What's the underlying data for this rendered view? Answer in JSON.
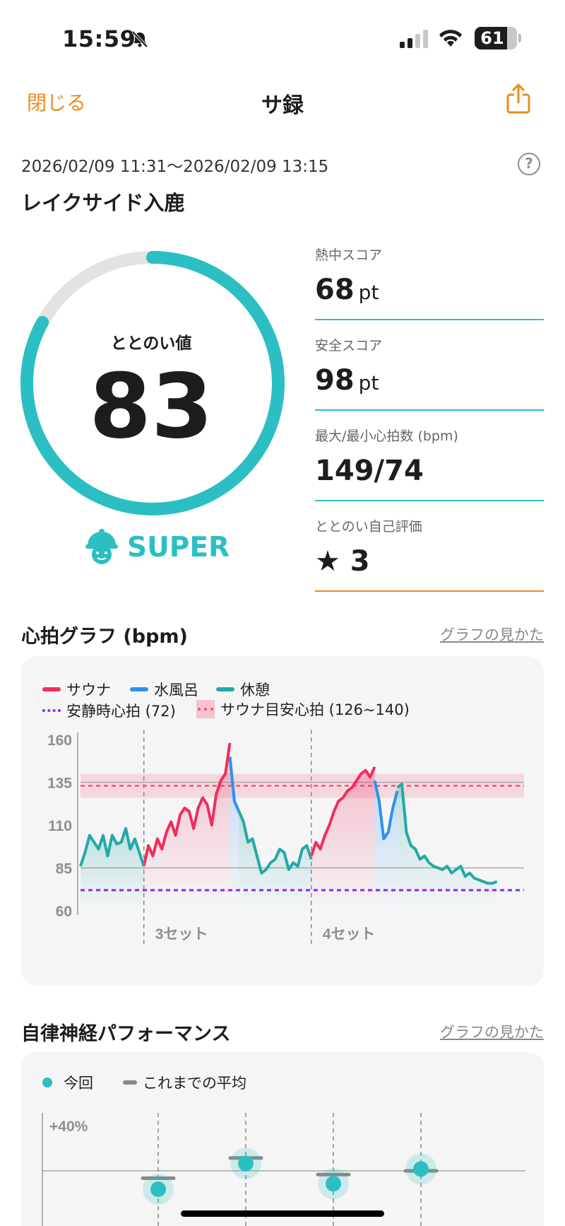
{
  "status": {
    "time": "15:59",
    "battery": "61"
  },
  "nav": {
    "back": "閉じる",
    "title": "サ録"
  },
  "session": {
    "range": "2026/02/09 11:31〜2026/02/09 13:15",
    "place": "レイクサイド入鹿",
    "help": "?"
  },
  "totonoi": {
    "label": "ととのい値",
    "value": "83",
    "percent": 0.83,
    "rank": "SUPER"
  },
  "stats": [
    {
      "label": "熱中スコア",
      "value": "68",
      "unit": "pt"
    },
    {
      "label": "安全スコア",
      "value": "98",
      "unit": "pt"
    },
    {
      "label": "最大/最小心拍数 (bpm)",
      "value": "149/74",
      "unit": ""
    },
    {
      "label": "ととのい自己評価",
      "value": "★ 3",
      "unit": ""
    }
  ],
  "heart": {
    "title": "心拍グラフ (bpm)",
    "link": "グラフの見かた",
    "legend": {
      "sauna": "サウナ",
      "water": "水風呂",
      "rest": "休憩",
      "resting": "安静時心拍 (72)",
      "target": "サウナ目安心拍 (126~140)"
    },
    "colors": {
      "sauna": "#ee2e5d",
      "water": "#2f8ff0",
      "rest": "#23a9a5",
      "resting": "#8a2be2",
      "target": "#f0557a"
    }
  },
  "chart_data": {
    "type": "line",
    "ylim": [
      60,
      160
    ],
    "yticks": [
      "160",
      "135",
      "110",
      "85",
      "60"
    ],
    "set_labels": [
      "3セット",
      "4セット"
    ],
    "resting_hr": 72,
    "target_zone": [
      126,
      140
    ],
    "segments": [
      {
        "phase": "rest",
        "values": [
          86,
          94,
          104,
          100,
          96,
          104,
          92,
          104,
          99,
          100,
          108,
          96,
          102,
          94,
          86
        ]
      },
      {
        "phase": "sauna",
        "values": [
          86,
          98,
          92,
          102,
          96,
          106,
          112,
          104,
          116,
          120,
          118,
          108,
          120,
          126,
          122,
          110,
          128,
          136,
          140,
          158
        ]
      },
      {
        "phase": "water",
        "values": [
          150,
          124,
          118
        ]
      },
      {
        "phase": "rest",
        "values": [
          118,
          112,
          100,
          102,
          92,
          82,
          84,
          88,
          90,
          96,
          94,
          84,
          88,
          86,
          96,
          98,
          90
        ]
      },
      {
        "phase": "sauna",
        "values": [
          92,
          100,
          96,
          104,
          110,
          118,
          124,
          126,
          130,
          132,
          136,
          140,
          142,
          138,
          144
        ]
      },
      {
        "phase": "water",
        "values": [
          136,
          124,
          102,
          106,
          120,
          130
        ]
      },
      {
        "phase": "rest",
        "values": [
          132,
          134,
          106,
          98,
          96,
          90,
          92,
          88,
          86,
          85,
          84,
          86,
          82,
          84,
          86,
          80,
          82,
          79,
          78,
          77,
          76,
          76,
          77
        ]
      }
    ]
  },
  "autonomic": {
    "title": "自律神経パフォーマンス",
    "link": "グラフの見かた",
    "legend_current": "今回",
    "legend_avg": "これまでの平均",
    "ytick": "+40%",
    "points": [
      {
        "current": -10,
        "avg": -4
      },
      {
        "current": 4,
        "avg": 7
      },
      {
        "current": -7,
        "avg": -2
      },
      {
        "current": 1,
        "avg": 0
      }
    ]
  }
}
